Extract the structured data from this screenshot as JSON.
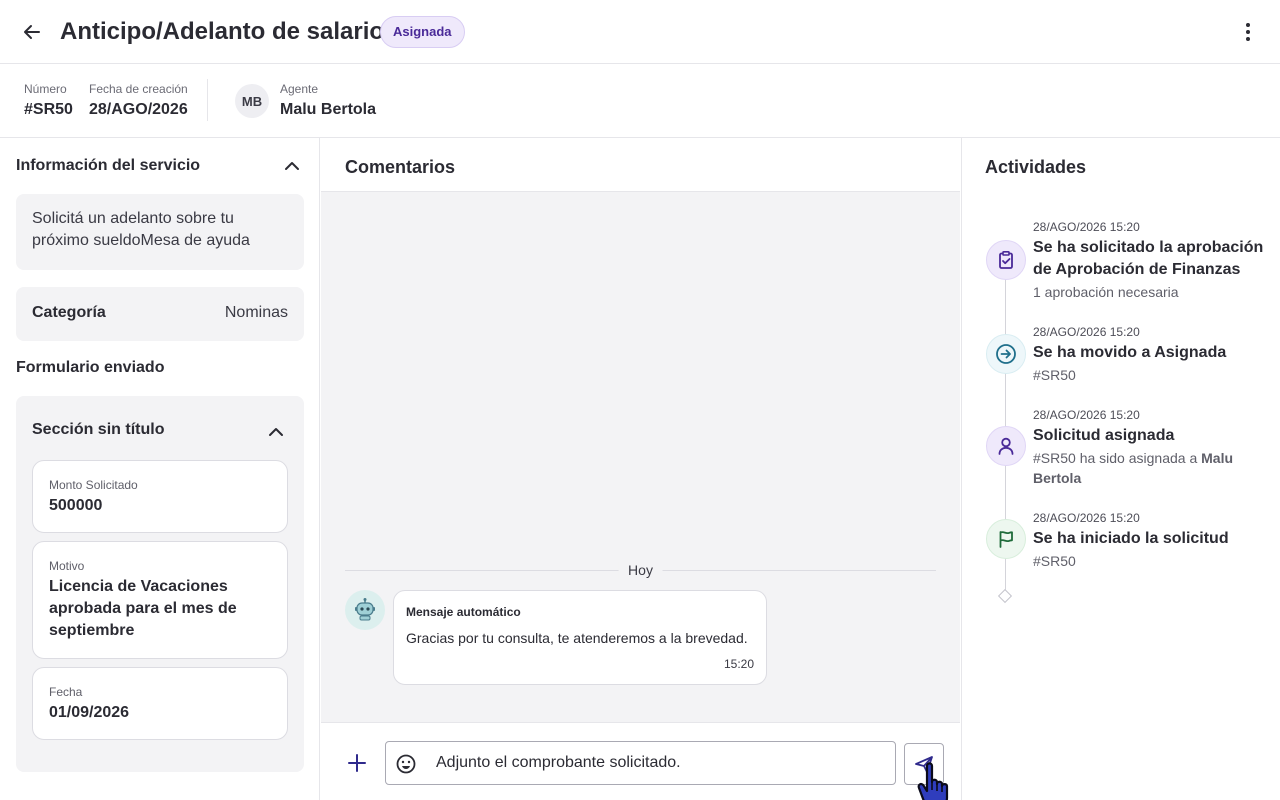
{
  "header": {
    "title": "Anticipo/Adelanto de salario",
    "status": "Asignada",
    "back_icon": "arrow-left-icon",
    "menu_icon": "more-vertical-icon"
  },
  "meta": {
    "number_label": "Número",
    "number_value": "#SR50",
    "created_label": "Fecha de creación",
    "created_value": "28/AGO/2026",
    "agent_initials": "MB",
    "agent_label": "Agente",
    "agent_value": "Malu Bertola"
  },
  "service_info": {
    "title": "Información del servicio",
    "description": "Solicitá un adelanto sobre tu próximo sueldoMesa de ayuda",
    "category_label": "Categoría",
    "category_value": "Nominas",
    "form_title": "Formulario enviado",
    "section_title": "Sección sin título",
    "fields": [
      {
        "label": "Monto Solicitado",
        "value": "500000"
      },
      {
        "label": "Motivo",
        "value": "Licencia de Vacaciones aprobada para el mes de septiembre"
      },
      {
        "label": "Fecha",
        "value": "01/09/2026"
      }
    ]
  },
  "comments": {
    "title": "Comentarios",
    "day_label": "Hoy",
    "message": {
      "sender": "Mensaje automático",
      "text": "Gracias por tu consulta, te atenderemos a la brevedad.",
      "time": "15:20"
    },
    "composer_value": "Adjunto el comprobante solicitado."
  },
  "activities": {
    "title": "Actividades",
    "items": [
      {
        "time": "28/AGO/2026 15:20",
        "title": "Se ha solicitado la aprobación de Aprobación de Finanzas",
        "detail": "1 aprobación necesaria",
        "icon": "clipboard-check-icon"
      },
      {
        "time": "28/AGO/2026 15:20",
        "title": "Se ha movido a Asignada",
        "detail": "#SR50",
        "icon": "arrow-right-circle-icon"
      },
      {
        "time": "28/AGO/2026 15:20",
        "title": "Solicitud asignada",
        "detail_prefix": "#SR50 ha sido asignada a ",
        "detail_bold": "Malu Bertola",
        "icon": "user-icon"
      },
      {
        "time": "28/AGO/2026 15:20",
        "title": "Se ha iniciado la solicitud",
        "detail": "#SR50",
        "icon": "flag-icon"
      }
    ]
  },
  "colors": {
    "accent": "#2f2a8c",
    "badge_bg": "#efe9fb",
    "badge_text": "#4a2a98",
    "panel_bg": "#f3f3f5",
    "approval_icon": "#4a2a98",
    "move_icon": "#1f6f8b",
    "flag_icon": "#1f6b3a"
  }
}
